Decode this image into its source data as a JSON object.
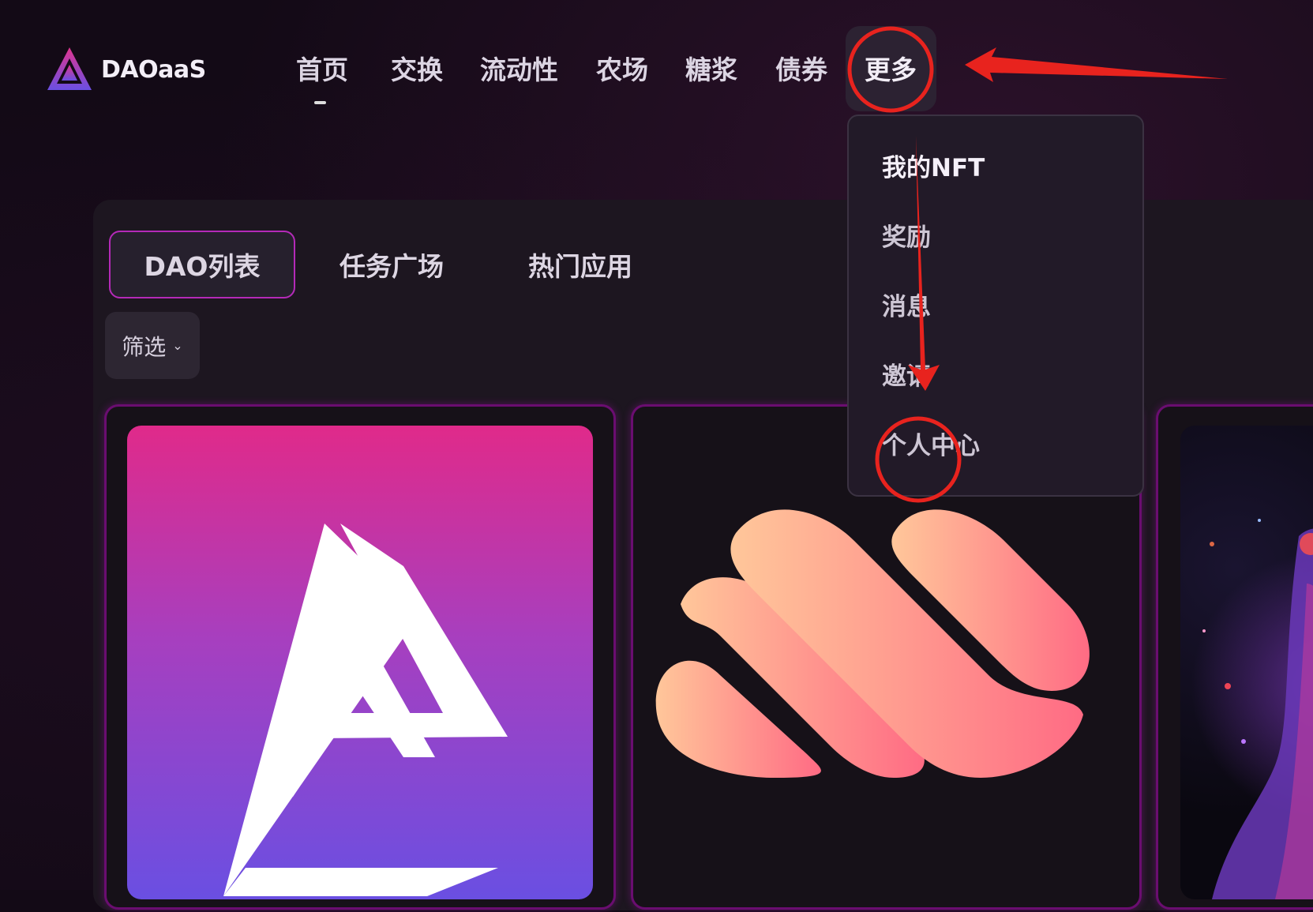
{
  "app": {
    "brand": "DAOaaS",
    "accent": "#b42ab8"
  },
  "nav": {
    "items": [
      {
        "label": "首页",
        "icon": null
      },
      {
        "label": "交换"
      },
      {
        "label": "流动性"
      },
      {
        "label": "农场"
      },
      {
        "label": "糖浆"
      },
      {
        "label": "债券"
      },
      {
        "label": "更多"
      }
    ],
    "active": "首页",
    "expanded": "更多"
  },
  "dropdown": {
    "items": [
      {
        "label": "我的NFT"
      },
      {
        "label": "奖励"
      },
      {
        "label": "消息"
      },
      {
        "label": "邀请"
      },
      {
        "label": "个人中心"
      }
    ]
  },
  "tabs": [
    {
      "label": "DAO列表",
      "active": true
    },
    {
      "label": "任务广场",
      "active": false
    },
    {
      "label": "热门应用",
      "active": false
    }
  ],
  "filter": {
    "label": "筛选",
    "icon": "chevron-down-icon"
  },
  "cards": [
    {
      "name": "dao-card-1",
      "image": "triangle-logo"
    },
    {
      "name": "dao-card-2",
      "image": "wave-logo"
    },
    {
      "name": "dao-card-3",
      "image": "robot-art"
    }
  ],
  "annotations": {
    "color": "#e8231e"
  }
}
